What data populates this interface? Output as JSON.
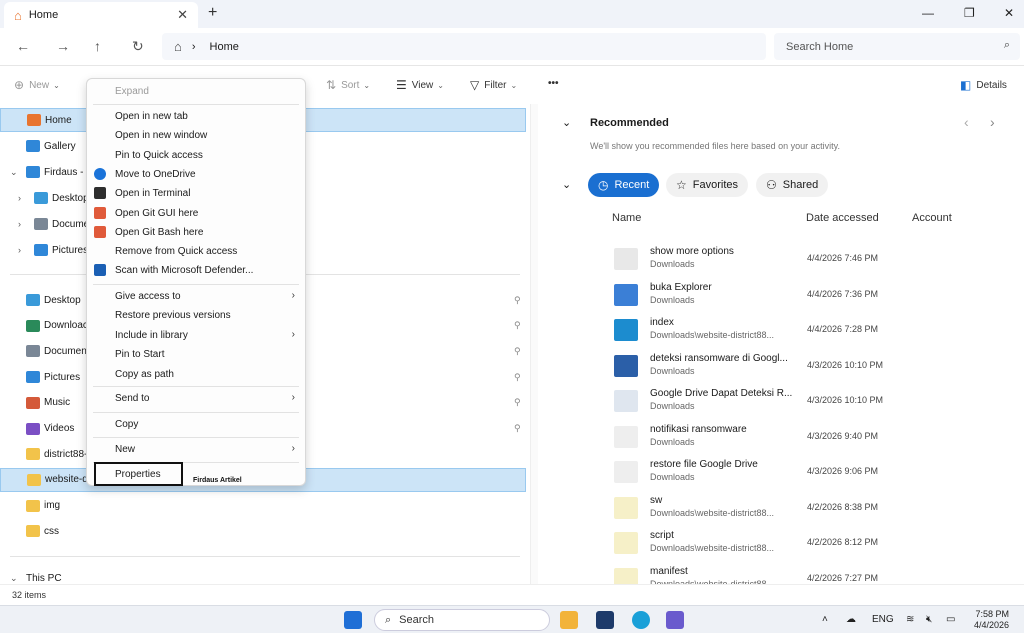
{
  "tabbar": {
    "tab_label": "Home",
    "close": "✕",
    "new_tab": "+",
    "minimize": "—",
    "maximize": "❐",
    "close_window": "✕"
  },
  "nav": {
    "back": "←",
    "forward": "→",
    "up": "↑",
    "refresh": "↻",
    "breadcrumb": "Home",
    "search_placeholder": "Search Home"
  },
  "cmdbar": {
    "new": "New",
    "sort": "Sort",
    "view": "View",
    "filter": "Filter",
    "more": "•••",
    "details": "Details"
  },
  "navpane": {
    "top": [
      {
        "label": "Home",
        "color": "#e8742f"
      },
      {
        "label": "Gallery",
        "color": "#2f87d8"
      },
      {
        "label": "Firdaus - P",
        "color": "#2f87d8"
      },
      {
        "label": "Desktop",
        "color": "#3a9ad9"
      },
      {
        "label": "Docume",
        "color": "#7a8796"
      },
      {
        "label": "Pictures",
        "color": "#2f87d8"
      }
    ],
    "quick": [
      {
        "label": "Desktop",
        "color": "#3a9ad9"
      },
      {
        "label": "Downloac",
        "color": "#2a8a5a"
      },
      {
        "label": "Documen",
        "color": "#7a8796"
      },
      {
        "label": "Pictures",
        "color": "#2f87d8"
      },
      {
        "label": "Music",
        "color": "#d45a3a"
      },
      {
        "label": "Videos",
        "color": "#7b4fc4"
      },
      {
        "label": "district88-",
        "color": "#f2c34a"
      },
      {
        "label": "website-d",
        "color": "#f2c34a"
      },
      {
        "label": "img",
        "color": "#f2c34a"
      },
      {
        "label": "css",
        "color": "#f2c34a"
      }
    ],
    "this_pc": "This PC"
  },
  "context_menu": {
    "expand": "Expand",
    "group1": [
      {
        "label": "Open in new tab",
        "color": ""
      },
      {
        "label": "Open in new window",
        "color": ""
      },
      {
        "label": "Pin to Quick access",
        "color": ""
      },
      {
        "label": "Move to OneDrive",
        "color": "#1a73d9"
      },
      {
        "label": "Open in Terminal",
        "color": "#2d2d2d"
      },
      {
        "label": "Open Git GUI here",
        "color": "#e05a3a"
      },
      {
        "label": "Open Git Bash here",
        "color": "#e05a3a"
      },
      {
        "label": "Remove from Quick access",
        "color": ""
      },
      {
        "label": "Scan with Microsoft Defender...",
        "color": "#1a5fb4"
      }
    ],
    "group2": [
      {
        "label": "Give access to",
        "sub": true
      },
      {
        "label": "Restore previous versions",
        "sub": false
      },
      {
        "label": "Include in library",
        "sub": true
      },
      {
        "label": "Pin to Start",
        "sub": false
      },
      {
        "label": "Copy as path",
        "sub": false
      }
    ],
    "send_to": "Send to",
    "copy": "Copy",
    "new": "New",
    "properties": "Properties",
    "watermark": "Firdaus Artikel"
  },
  "recommended": {
    "title": "Recommended",
    "hint": "We'll show you recommended files here based on your activity."
  },
  "recent_tabs": {
    "recent": "Recent",
    "favorites": "Favorites",
    "shared": "Shared"
  },
  "columns": {
    "name": "Name",
    "date": "Date accessed",
    "account": "Account"
  },
  "files": [
    {
      "name": "show more options",
      "location": "Downloads",
      "date": "4/4/2026 7:46 PM",
      "thumb": "#e8e8e8"
    },
    {
      "name": "buka Explorer",
      "location": "Downloads",
      "date": "4/4/2026 7:36 PM",
      "thumb": "#3b7fd6"
    },
    {
      "name": "index",
      "location": "Downloads\\website-district88...",
      "date": "4/4/2026 7:28 PM",
      "thumb": "#1c8ccf"
    },
    {
      "name": "deteksi ransomware di Googl...",
      "location": "Downloads",
      "date": "4/3/2026 10:10 PM",
      "thumb": "#2b5fa8"
    },
    {
      "name": "Google Drive Dapat Deteksi R...",
      "location": "Downloads",
      "date": "4/3/2026 10:10 PM",
      "thumb": "#dfe6ef"
    },
    {
      "name": "notifikasi ransomware",
      "location": "Downloads",
      "date": "4/3/2026 9:40 PM",
      "thumb": "#eeeeee"
    },
    {
      "name": "restore file Google Drive",
      "location": "Downloads",
      "date": "4/3/2026 9:06 PM",
      "thumb": "#eeeeee"
    },
    {
      "name": "sw",
      "location": "Downloads\\website-district88...",
      "date": "4/2/2026 8:38 PM",
      "thumb": "#f6f0c8"
    },
    {
      "name": "script",
      "location": "Downloads\\website-district88...",
      "date": "4/2/2026 8:12 PM",
      "thumb": "#f6f0c8"
    },
    {
      "name": "manifest",
      "location": "Downloads\\website-district88...",
      "date": "4/2/2026 7:27 PM",
      "thumb": "#f6f0c8"
    }
  ],
  "status": {
    "items": "32 items"
  },
  "taskbar": {
    "search": "Search",
    "lang": "ENG",
    "time": "7:58 PM",
    "date": "4/4/2026"
  }
}
